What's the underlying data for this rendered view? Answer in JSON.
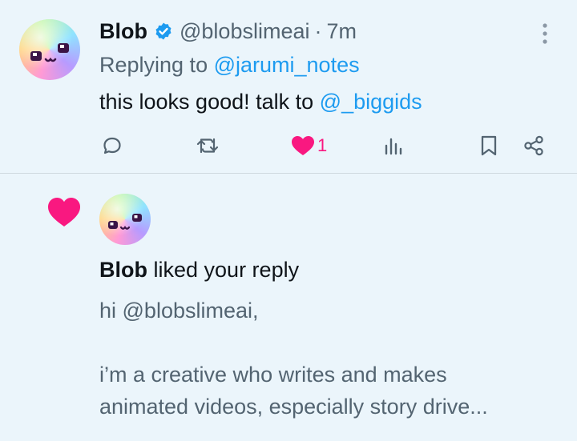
{
  "tweet": {
    "author_name": "Blob",
    "handle": "@blobslimeai",
    "separator": "·",
    "time": "7m",
    "replying_prefix": "Replying to ",
    "replying_to": "@jarumi_notes",
    "text_prefix": "this looks good! talk to ",
    "text_mention": "@_biggids",
    "like_count": "1"
  },
  "notification": {
    "actor": "Blob",
    "action": " liked your reply",
    "preview_line1": "hi @blobslimeai,",
    "preview_line2": "i’m a creative who writes and makes",
    "preview_line3": "animated videos, especially story drive..."
  },
  "icons": {
    "verified": "verified-badge-icon",
    "more": "more-options-icon",
    "reply": "reply-icon",
    "retweet": "retweet-icon",
    "like": "heart-icon",
    "views": "views-icon",
    "bookmark": "bookmark-icon",
    "share": "share-icon",
    "notif_like": "heart-icon"
  },
  "colors": {
    "background": "#ebf5fb",
    "link": "#1d9bf0",
    "like": "#f91880",
    "muted": "#536471",
    "text": "#0f1419"
  }
}
